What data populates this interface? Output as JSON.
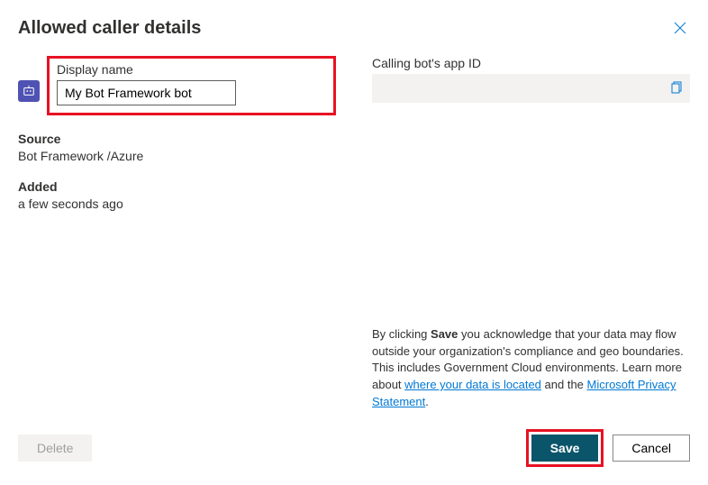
{
  "title": "Allowed caller details",
  "left": {
    "display_name_label": "Display name",
    "display_name_value": "My Bot Framework bot",
    "source_label": "Source",
    "source_value": "Bot Framework /Azure",
    "added_label": "Added",
    "added_value": "a few seconds ago"
  },
  "right": {
    "app_id_label": "Calling bot's app ID",
    "app_id_value": "",
    "disclaimer_pre": "By clicking ",
    "disclaimer_bold": "Save",
    "disclaimer_mid": " you acknowledge that your data may flow outside your organization's compliance and geo boundaries. This includes Government Cloud environments. Learn more about ",
    "link1": "where your data is located",
    "disclaimer_and": " and the ",
    "link2": "Microsoft Privacy Statement",
    "disclaimer_end": "."
  },
  "footer": {
    "delete": "Delete",
    "save": "Save",
    "cancel": "Cancel"
  }
}
